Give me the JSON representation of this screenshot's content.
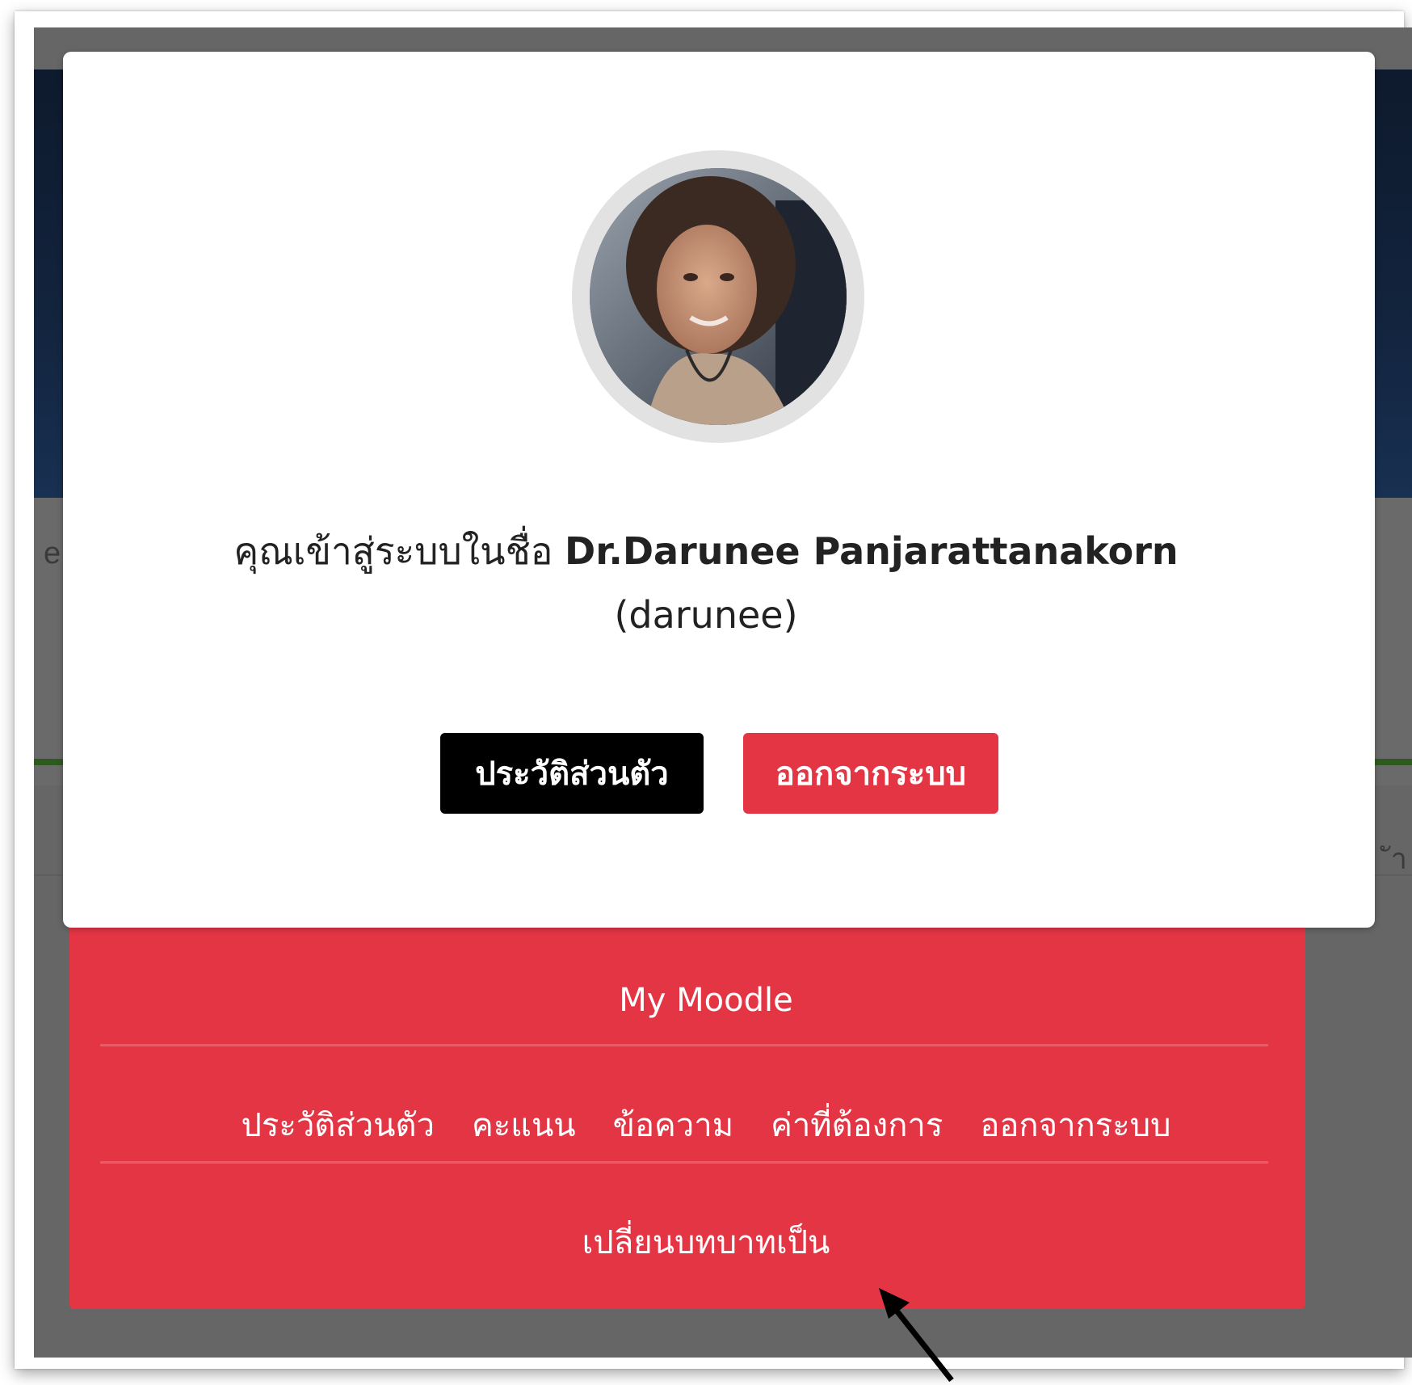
{
  "login_prefix": "คุณเข้าสู่ระบบในชื่อ",
  "full_name": "Dr.Darunee Panjarattanakorn",
  "username": "(darunee)",
  "buttons": {
    "profile": "ประวัติส่วนตัว",
    "logout": "ออกจากระบบ"
  },
  "menu": {
    "my_moodle": "My Moodle",
    "links": [
      "ประวัติส่วนตัว",
      "คะแนน",
      "ข้อความ",
      "ค่าที่ต้องการ",
      "ออกจากระบบ"
    ],
    "switch_role": "เปลี่ยนบทบาทเป็น"
  },
  "background_fragments": {
    "left": "e",
    "right": "ัา"
  },
  "colors": {
    "accent_red": "#e43545",
    "overlay": "#666666",
    "profile_button": "#000000"
  }
}
